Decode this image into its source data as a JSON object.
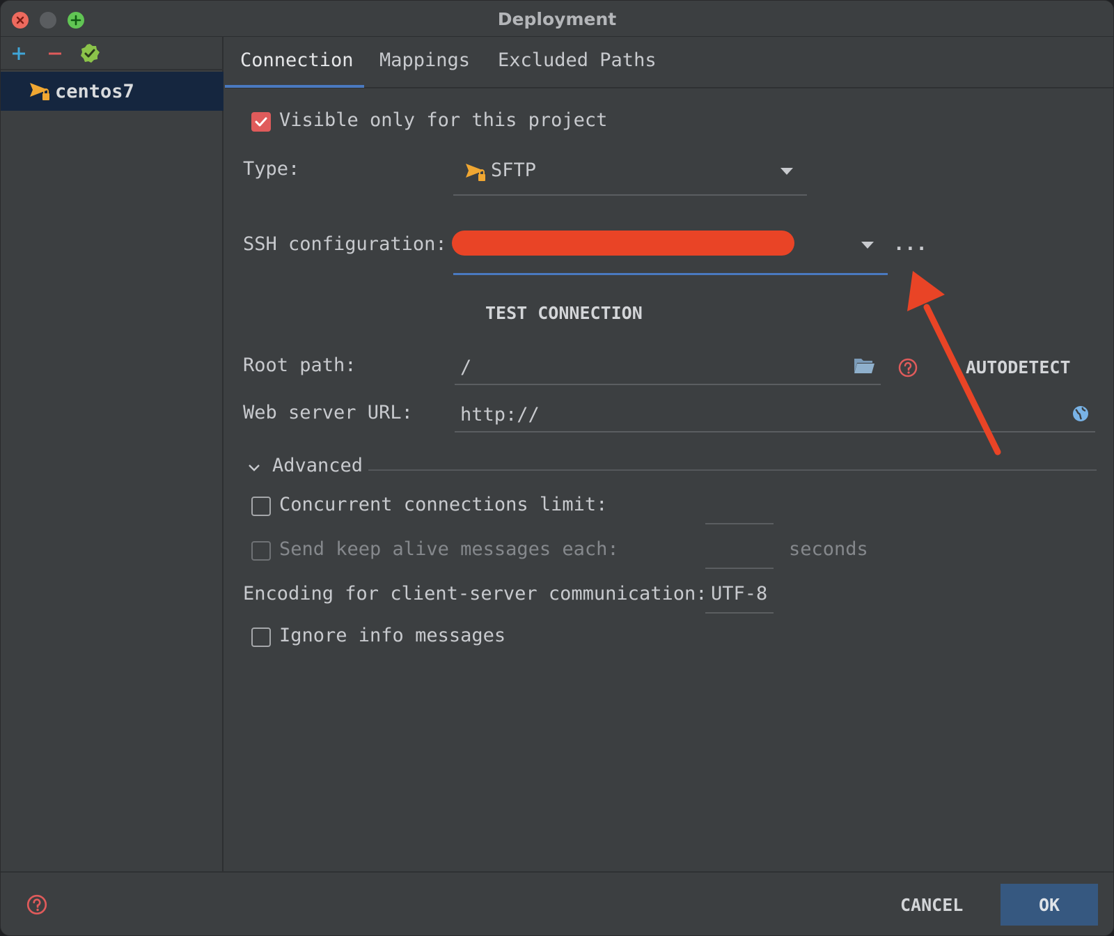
{
  "window": {
    "title": "Deployment"
  },
  "sidebar": {
    "items": [
      {
        "label": "centos7"
      }
    ]
  },
  "tabs": [
    {
      "label": "Connection"
    },
    {
      "label": "Mappings"
    },
    {
      "label": "Excluded Paths"
    }
  ],
  "connection": {
    "visible_only_label": "Visible only for this project",
    "type_label": "Type:",
    "type_value": "SFTP",
    "ssh_label": "SSH configuration:",
    "ssh_more": "...",
    "test_connection": "TEST CONNECTION",
    "root_path_label": "Root path:",
    "root_path_value": "/",
    "autodetect": "AUTODETECT",
    "web_url_label": "Web server URL:",
    "web_url_value": "http://"
  },
  "advanced": {
    "header": "Advanced",
    "concurrent_label": "Concurrent connections limit:",
    "keepalive_label": "Send keep alive messages each:",
    "seconds": "seconds",
    "encoding_label": "Encoding for client-server communication:",
    "encoding_value": "UTF-8",
    "ignore_info_label": "Ignore info messages"
  },
  "footer": {
    "cancel": "CANCEL",
    "ok": "OK"
  },
  "colors": {
    "accent": "#4a79c0",
    "checkbox": "#e05b5b",
    "ok_button": "#365880",
    "redaction": "#e94426",
    "annotation_arrow": "#e94426"
  }
}
